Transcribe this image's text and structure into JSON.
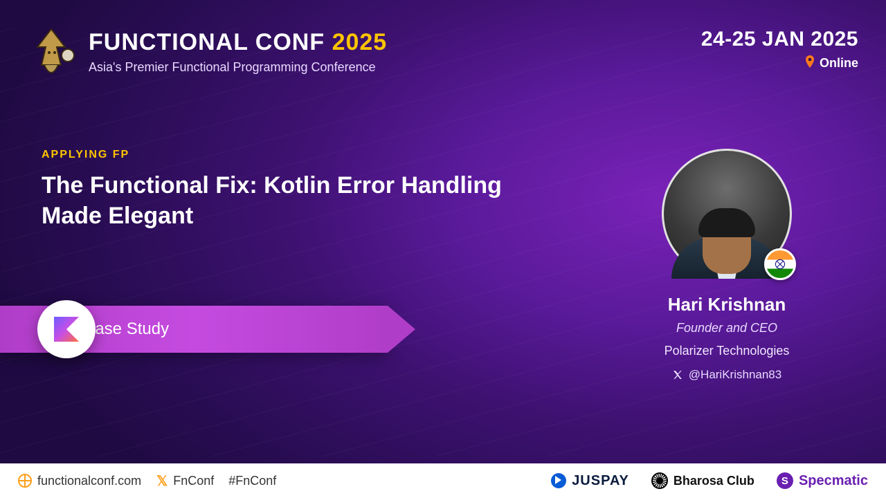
{
  "header": {
    "conf_name_part1": "FUNCTIONAL CONF ",
    "conf_year": "2025",
    "tagline": "Asia's Premier Functional Programming Conference",
    "dates": "24-25 JAN 2025",
    "mode": "Online"
  },
  "talk": {
    "track": "APPLYING FP",
    "title": "The Functional Fix: Kotlin Error Handling Made Elegant",
    "badge_lang": "Kotlin",
    "session_type": "Case Study"
  },
  "speaker": {
    "name": "Hari Krishnan",
    "role": "Founder and CEO",
    "org": "Polarizer Technologies",
    "handle": "@HariKrishnan83",
    "country_flag": "India"
  },
  "footer": {
    "website": "functionalconf.com",
    "social_handle": "FnConf",
    "hashtag": "#FnConf",
    "sponsors": [
      {
        "name": "JUSPAY"
      },
      {
        "name": "Bharosa Club"
      },
      {
        "name": "Specmatic"
      }
    ]
  }
}
